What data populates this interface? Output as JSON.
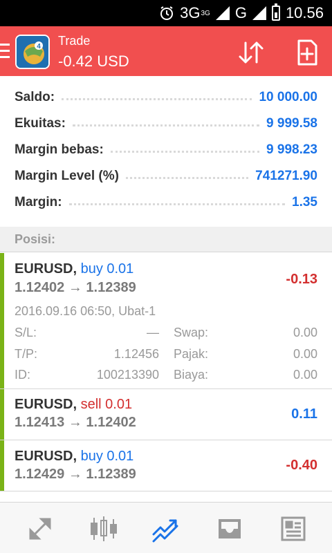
{
  "status_bar": {
    "network": "3G",
    "network_sup": "3G",
    "network2": "G",
    "time": "10.56"
  },
  "header": {
    "title": "Trade",
    "subtitle": "-0.42 USD"
  },
  "account": {
    "rows": [
      {
        "label": "Saldo:",
        "value": "10 000.00"
      },
      {
        "label": "Ekuitas:",
        "value": "9 999.58"
      },
      {
        "label": "Margin bebas:",
        "value": "9 998.23"
      },
      {
        "label": "Margin Level (%)",
        "value": "741271.90"
      },
      {
        "label": "Margin:",
        "value": "1.35"
      }
    ]
  },
  "positions_header": "Posisi:",
  "positions": [
    {
      "symbol": "EURUSD,",
      "type": "buy 0.01",
      "prices": "1.12402 → 1.12389",
      "profit": "-0.13",
      "time": "2016.09.16 06:50, Ubat-1",
      "sl_label": "S/L:",
      "sl": "—",
      "swap_label": "Swap:",
      "swap": "0.00",
      "tp_label": "T/P:",
      "tp": "1.12456",
      "tax_label": "Pajak:",
      "tax": "0.00",
      "id_label": "ID:",
      "id": "100213390",
      "fee_label": "Biaya:",
      "fee": "0.00"
    },
    {
      "symbol": "EURUSD,",
      "type": "sell 0.01",
      "prices": "1.12413 → 1.12402",
      "profit": "0.11"
    },
    {
      "symbol": "EURUSD,",
      "type": "buy 0.01",
      "prices": "1.12429 → 1.12389",
      "profit": "-0.40"
    }
  ],
  "bottom_nav": [
    {
      "icon": "quotes-icon"
    },
    {
      "icon": "chart-icon"
    },
    {
      "icon": "trade-icon",
      "active": true
    },
    {
      "icon": "history-icon"
    },
    {
      "icon": "news-icon"
    }
  ],
  "colors": {
    "header": "#f14f4f",
    "accent": "#1a73e8",
    "loss": "#d32f2f",
    "position_bar": "#7ab317"
  }
}
